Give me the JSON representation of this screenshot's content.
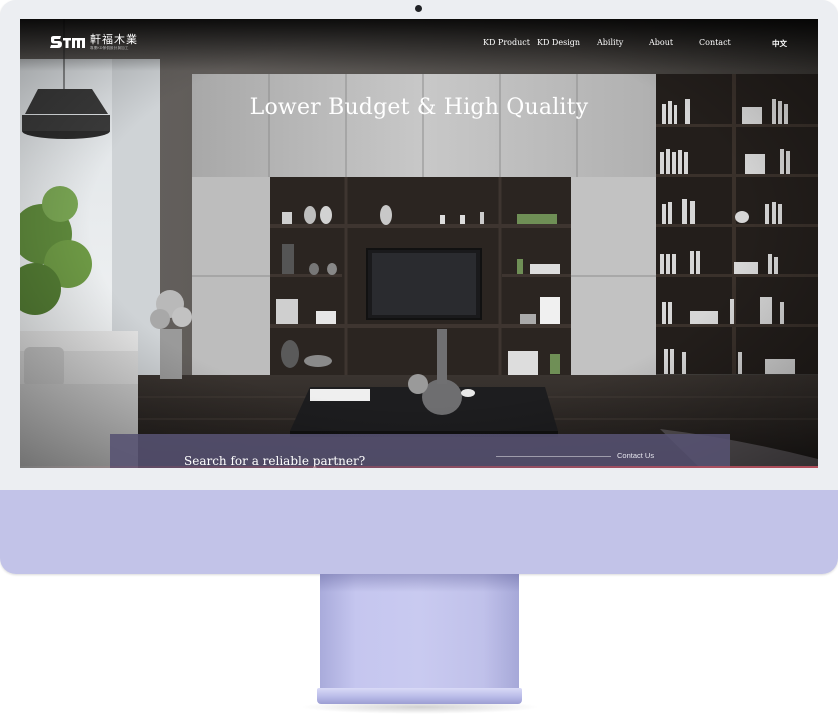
{
  "site": {
    "logo_cn": "軒福木業",
    "logo_sub": "專業KD傢俱設計與加工"
  },
  "nav": {
    "items": [
      {
        "label": "KD Product"
      },
      {
        "label": "KD Design"
      },
      {
        "label": "Ability"
      },
      {
        "label": "About"
      },
      {
        "label": "Contact"
      }
    ],
    "language": "中文"
  },
  "hero": {
    "title": "Lower Budget & High Quality"
  },
  "cta": {
    "text": "Search for a reliable partner?",
    "link": "Contact Us"
  },
  "colors": {
    "cta_bar": "#565272",
    "device_chin": "#c2c3e8",
    "device_frame": "#eceef2"
  }
}
